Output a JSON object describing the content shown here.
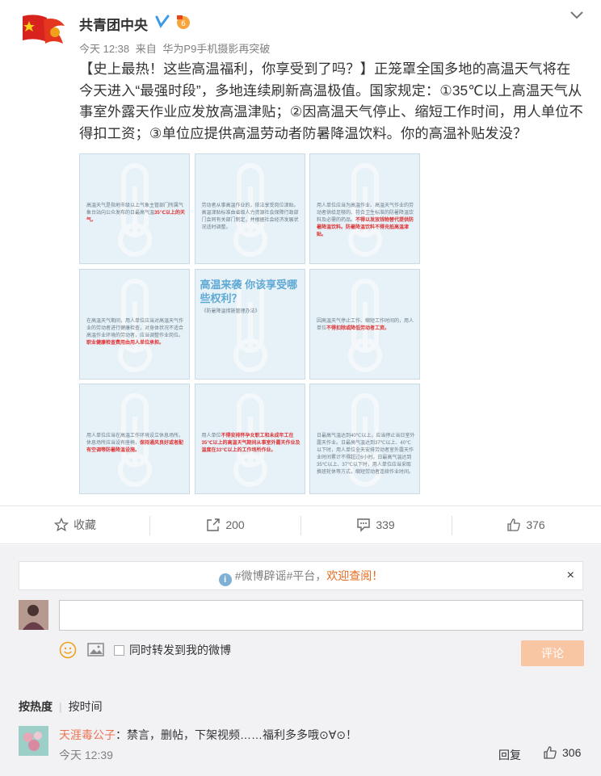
{
  "post": {
    "author": "共青团中央",
    "time": "今天 12:38",
    "via_prefix": "来自",
    "via": "华为P9手机摄影再突破",
    "text": "【史上最热！这些高温福利，你享受到了吗？】正笼罩全国多地的高温天气将在今天进入“最强时段”，多地连续刷新高温极值。国家规定：①35℃以上高温天气从事室外露天作业应发放高温津贴；②因高温天气停止、缩短工作时间，用人单位不得扣工资；③单位应提供高温劳动者防暑降温饮料。你的高温补贴发没？",
    "images": [
      {
        "text": "高温天气是指地市级以上气象主管部门所属气象台站向公众发布的日最高气温",
        "highlight": "35℃以上的天气。"
      },
      {
        "text": "劳动者从事高温作业的，依法享受岗位津贴。高温津贴标准由省级人力资源社会保障行政部门会同有关部门制定，并根据社会经济发展状况适时调整。",
        "highlight": ""
      },
      {
        "text": "用人单位应当为高温作业、高温天气作业的劳动者供给足够的、符合卫生标准的防暑降温饮料及必需的药品。",
        "highlight": "不得以发放钱物替代提供防暑降温饮料。防暑降温饮料不得充抵高温津贴。"
      },
      {
        "text": "在高温天气期间，用人单位应当对高温天气作业的劳动者进行健康检查，对身体状况不适合高温作业环境的劳动者，应当调整作业岗位。",
        "highlight": "职业健康检查费用由用人单位承担。"
      },
      {
        "big": "高温来袭 你该享受哪些权利？",
        "text": "《防暑降温措施管理办法》",
        "highlight": ""
      },
      {
        "text": "因高温天气停止工作、缩短工作时间的，用人单位",
        "highlight": "不得扣除或降低劳动者工资。"
      },
      {
        "text": "用人单位应当在高温工作环境设立休息场所。休息场所应当设有座椅，",
        "highlight": "保持通风良好或者配有空调等防暑降温设施。"
      },
      {
        "text": "用人单位",
        "highlight": "不得安排怀孕女职工和未成年工在35℃以上的高温天气期间从事室外露天作业及温度在33℃以上的工作场所作业。"
      },
      {
        "text": "日最高气温达到40℃以上，应当停止当日室外露天作业。日最高气温达到37℃以上、40℃以下时，用人单位全天安排劳动者室外露天作业时间累计不得超过6小时。日最高气温达到35℃以上、37℃以下时，用人单位应当采取换班轮休等方式，缩短劳动者连续作业时间。",
        "highlight": ""
      }
    ]
  },
  "actions": {
    "favorite": "收藏",
    "forward": "200",
    "comment": "339",
    "like": "376"
  },
  "notice": {
    "prefix": "#微博辟谣#平台，",
    "highlight": "欢迎查阅！",
    "close": "×"
  },
  "composer": {
    "placeholder": "",
    "repost_label": "同时转发到我的微博",
    "submit": "评论"
  },
  "sort": {
    "hot": "按热度",
    "time": "按时间"
  },
  "comments": [
    {
      "user": "天涯毒公子",
      "text": "：禁言，删帖，下架视频……福利多多哦⊙∀⊙！",
      "time": "今天 12:39",
      "reply": "回复",
      "likes": "306"
    }
  ],
  "colors": {
    "accent": "#eb7350",
    "submit_bg": "#f9c6a3",
    "tile_bg": "#e7f1f8",
    "highlight_red": "#d33333"
  }
}
